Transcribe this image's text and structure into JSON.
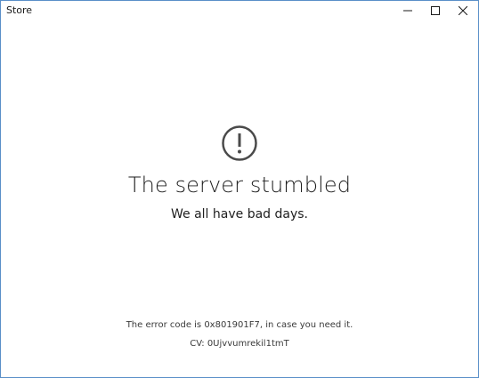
{
  "window": {
    "title": "Store",
    "border_color": "#5a8fc8"
  },
  "controls": {
    "minimize_icon": "minimize-icon",
    "maximize_icon": "maximize-icon",
    "close_icon": "close-icon"
  },
  "error": {
    "icon": "exclamation-circle-icon",
    "headline": "The server stumbled",
    "subline": "We all have bad days.",
    "code_text": "The error code is 0x801901F7, in case you need it.",
    "cv_text": "CV: 0Ujvvumrekil1tmT"
  }
}
